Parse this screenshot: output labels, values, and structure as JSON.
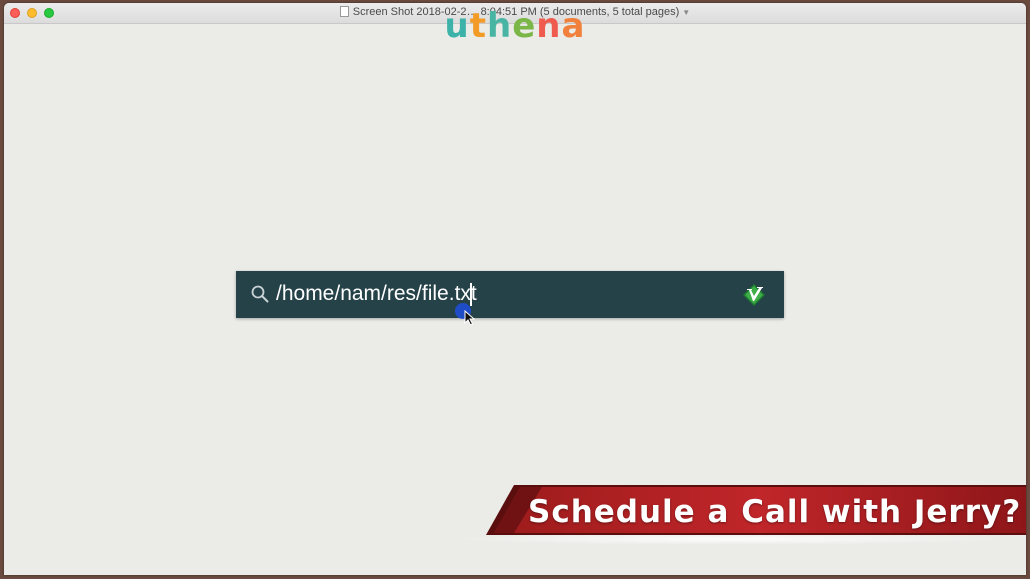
{
  "window": {
    "title": "Screen Shot 2018-02-2… 8:04:51 PM (5 documents, 5 total pages)"
  },
  "logo": {
    "letters": [
      "u",
      "t",
      "h",
      "e",
      "n",
      "a"
    ]
  },
  "search": {
    "value": "/home/nam/res/file.txt",
    "icon": "magnifier-icon",
    "app_icon": "vim-icon"
  },
  "banner": {
    "text": "Schedule a Call with Jerry?"
  },
  "colors": {
    "searchbar_bg": "#254249",
    "banner_red": "#b3201f",
    "window_bg": "#ebebe8"
  }
}
